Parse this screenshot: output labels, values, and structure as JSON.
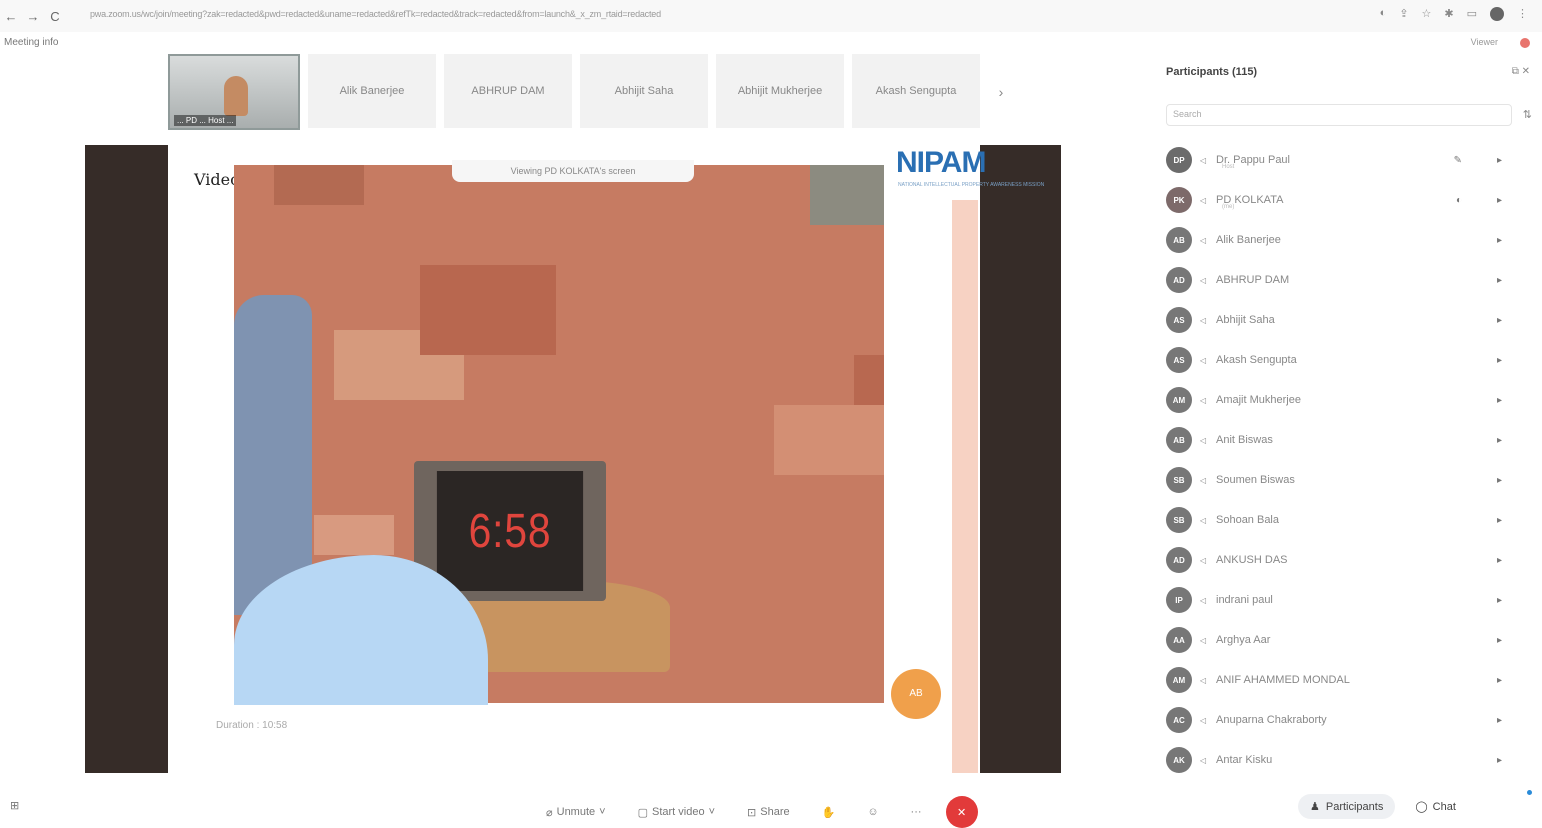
{
  "browser": {
    "back": "←",
    "forward": "→",
    "reload": "C",
    "url": "pwa.zoom.us/wc/join/meeting?zak=redacted&pwd=redacted&uname=redacted&refTk=redacted&track=redacted&from=launch&_x_zm_rtaid=redacted",
    "icons": [
      "cast-icon",
      "star-icon",
      "extension-icon",
      "puzzle-icon",
      "profile-icon",
      "menu-icon"
    ]
  },
  "meeting": {
    "info_label": "Meeting info",
    "top_right": "Viewer"
  },
  "thumbnails": {
    "self_name": "... PD ... Host ...",
    "participants": [
      "Alik Banerjee",
      "ABHRUP DAM",
      "Abhijit Saha",
      "Abhijit Mukherjee",
      "Akash Sengupta"
    ],
    "next": "›"
  },
  "share": {
    "viewing_banner": "Viewing PD KOLKATA's screen",
    "slide_title": "Video",
    "logo": "NIPAM",
    "logo_sub": "NATIONAL INTELLECTUAL PROPERTY AWARENESS MISSION",
    "clock_time": "6:58",
    "duration_text": "Duration : 10:58",
    "fab_label": "AB"
  },
  "panel": {
    "title": "Participants (115)",
    "search_placeholder": "Search",
    "participants": [
      {
        "initials": "DP",
        "name": "Dr. Pappu Paul",
        "sub": "Host",
        "avatar_color": "#6b6b6b",
        "video": "✎",
        "mic": "▸"
      },
      {
        "initials": "PK",
        "name": "PD KOLKATA",
        "sub": "(me)",
        "avatar_color": "#7d6a6a",
        "video": "◐",
        "mic": "▸"
      },
      {
        "initials": "AB",
        "name": "Alik Banerjee",
        "sub": "",
        "avatar_color": "#777777",
        "video": "",
        "mic": "▸"
      },
      {
        "initials": "AD",
        "name": "ABHRUP DAM",
        "sub": "",
        "avatar_color": "#777777",
        "video": "",
        "mic": "▸"
      },
      {
        "initials": "AS",
        "name": "Abhijit Saha",
        "sub": "",
        "avatar_color": "#777777",
        "video": "",
        "mic": "▸"
      },
      {
        "initials": "AS",
        "name": "Akash Sengupta",
        "sub": "",
        "avatar_color": "#777777",
        "video": "",
        "mic": "▸"
      },
      {
        "initials": "AM",
        "name": "Amajit Mukherjee",
        "sub": "",
        "avatar_color": "#777777",
        "video": "",
        "mic": "▸"
      },
      {
        "initials": "AB",
        "name": "Anit Biswas",
        "sub": "",
        "avatar_color": "#777777",
        "video": "",
        "mic": "▸"
      },
      {
        "initials": "SB",
        "name": "Soumen Biswas",
        "sub": "",
        "avatar_color": "#777777",
        "video": "",
        "mic": "▸"
      },
      {
        "initials": "SB",
        "name": "Sohoan Bala",
        "sub": "",
        "avatar_color": "#777777",
        "video": "",
        "mic": "▸"
      },
      {
        "initials": "AD",
        "name": "ANKUSH DAS",
        "sub": "",
        "avatar_color": "#777777",
        "video": "",
        "mic": "▸"
      },
      {
        "initials": "IP",
        "name": "indrani paul",
        "sub": "",
        "avatar_color": "#777777",
        "video": "",
        "mic": "▸"
      },
      {
        "initials": "AA",
        "name": "Arghya Aar",
        "sub": "",
        "avatar_color": "#777777",
        "video": "",
        "mic": "▸"
      },
      {
        "initials": "AM",
        "name": "ANIF AHAMMED MONDAL",
        "sub": "",
        "avatar_color": "#777777",
        "video": "",
        "mic": "▸"
      },
      {
        "initials": "AC",
        "name": "Anuparna Chakraborty",
        "sub": "",
        "avatar_color": "#777777",
        "video": "",
        "mic": "▸"
      },
      {
        "initials": "AK",
        "name": "Antar Kisku",
        "sub": "",
        "avatar_color": "#777777",
        "video": "",
        "mic": "▸"
      }
    ]
  },
  "toolbar": {
    "left_icon": "⊞",
    "unmute": "Unmute",
    "start_video": "Start video",
    "share": "Share",
    "more": "···",
    "participants": "Participants",
    "chat": "Chat"
  },
  "colors": {
    "video_bg": "#c67b62",
    "end_button": "#e23a3a",
    "logo": "#2a6fb3",
    "clock_digits": "#e0453d"
  }
}
